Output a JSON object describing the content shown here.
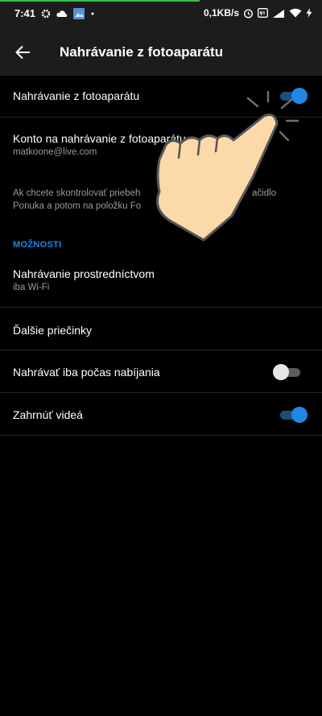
{
  "status_bar": {
    "time": "7:41",
    "network_speed": "0,1KB/s",
    "icons": [
      "gear-icon",
      "cloud-icon",
      "gallery-icon",
      "dot-icon",
      "alarm-icon",
      "vowifi-icon",
      "signal-4g-icon",
      "wifi-icon",
      "charging-icon"
    ]
  },
  "header": {
    "title": "Nahrávanie z fotoaparátu",
    "back_icon": "arrow-left-icon"
  },
  "settings": {
    "camera_upload": {
      "label": "Nahrávanie z fotoaparátu",
      "enabled": true
    },
    "account": {
      "label": "Konto na nahrávanie z fotoaparátu",
      "email": "matkoone@live.com"
    },
    "hint": {
      "line1": "Ak chcete skontrolovať priebeh",
      "line1_end": "ačidlo",
      "line2": "Ponuka a potom na položku Fo"
    },
    "options_header": "MOŽNOSTI",
    "upload_via": {
      "label": "Nahrávanie prostredníctvom",
      "value": "iba Wi-Fi"
    },
    "more_folders": {
      "label": "Ďalšie priečinky"
    },
    "charging_only": {
      "label": "Nahrávať iba počas nabíjania",
      "enabled": false
    },
    "include_videos": {
      "label": "Zahrnúť videá",
      "enabled": true
    }
  },
  "colors": {
    "accent": "#1e88e5",
    "background": "#000000",
    "bar": "#1c1c1c",
    "progress": "#39c04a",
    "hand": "#fcd9a9"
  }
}
